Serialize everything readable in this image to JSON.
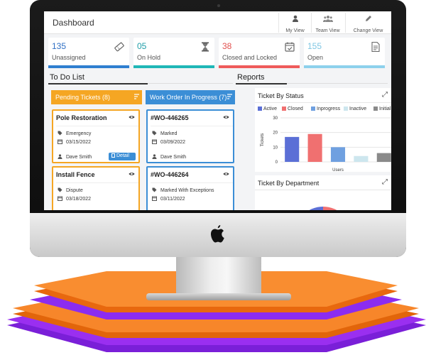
{
  "header": {
    "title": "Dashboard",
    "views": [
      {
        "label": "My View",
        "icon": "user-icon"
      },
      {
        "label": "Team View",
        "icon": "team-icon"
      },
      {
        "label": "Change View",
        "icon": "edit-icon"
      }
    ]
  },
  "stats": [
    {
      "value": "135",
      "label": "Unassigned",
      "color": "#2f6fc4",
      "bar": "#2f7fd0",
      "icon": "ticket-icon"
    },
    {
      "value": "05",
      "label": "On Hold",
      "color": "#1f9ea8",
      "bar": "#1fb7b7",
      "icon": "hourglass-icon"
    },
    {
      "value": "38",
      "label": "Closed and Locked",
      "color": "#e2504e",
      "bar": "#ef5b5b",
      "icon": "calendar-check-icon"
    },
    {
      "value": "155",
      "label": "Open",
      "color": "#7fc6e3",
      "bar": "#8dd1ec",
      "icon": "document-icon"
    }
  ],
  "todo": {
    "title": "To Do List",
    "columns": [
      {
        "header": "Pending Tickets (8)",
        "color": "#f5a623",
        "cards": [
          {
            "title": "Pole Restoration",
            "type": "Emergency",
            "date": "03/15/2022",
            "user": "Dave Smith",
            "action": "Detail"
          },
          {
            "title": "Install Fence",
            "type": "Dispute",
            "date": "03/18/2022"
          }
        ]
      },
      {
        "header": "Work Order In Progress (7)",
        "color": "#3b8ed6",
        "cards": [
          {
            "title": "#WO-446265",
            "type": "Marked",
            "date": "03/09/2022",
            "user": "Dave Smith"
          },
          {
            "title": "#WO-446264",
            "type": "Marked With Exceptions",
            "date": "03/11/2022"
          }
        ]
      }
    ]
  },
  "reports": {
    "title": "Reports",
    "status_panel": {
      "title": "Ticket By Status"
    },
    "department_panel": {
      "title": "Ticket By Department"
    }
  },
  "chart_data": {
    "type": "bar",
    "title": "Ticket By Status",
    "xlabel": "Users",
    "ylabel": "Tickets",
    "ylim": [
      0,
      30
    ],
    "yticks": [
      0,
      10,
      20,
      30
    ],
    "categories": [
      "Users"
    ],
    "series": [
      {
        "name": "Active",
        "values": [
          17
        ],
        "color": "#5b6fd6"
      },
      {
        "name": "Closed",
        "values": [
          19
        ],
        "color": "#f07070"
      },
      {
        "name": "Inprogress",
        "values": [
          10
        ],
        "color": "#6fa0e0"
      },
      {
        "name": "Inactive",
        "values": [
          4
        ],
        "color": "#cde6ee"
      },
      {
        "name": "Initial",
        "values": [
          6
        ],
        "color": "#8a8a8a"
      }
    ],
    "grid": true,
    "legend": "top"
  },
  "department_chart": {
    "type": "pie",
    "slices": [
      {
        "color": "#5b6fd6"
      },
      {
        "color": "#f07070"
      }
    ]
  }
}
